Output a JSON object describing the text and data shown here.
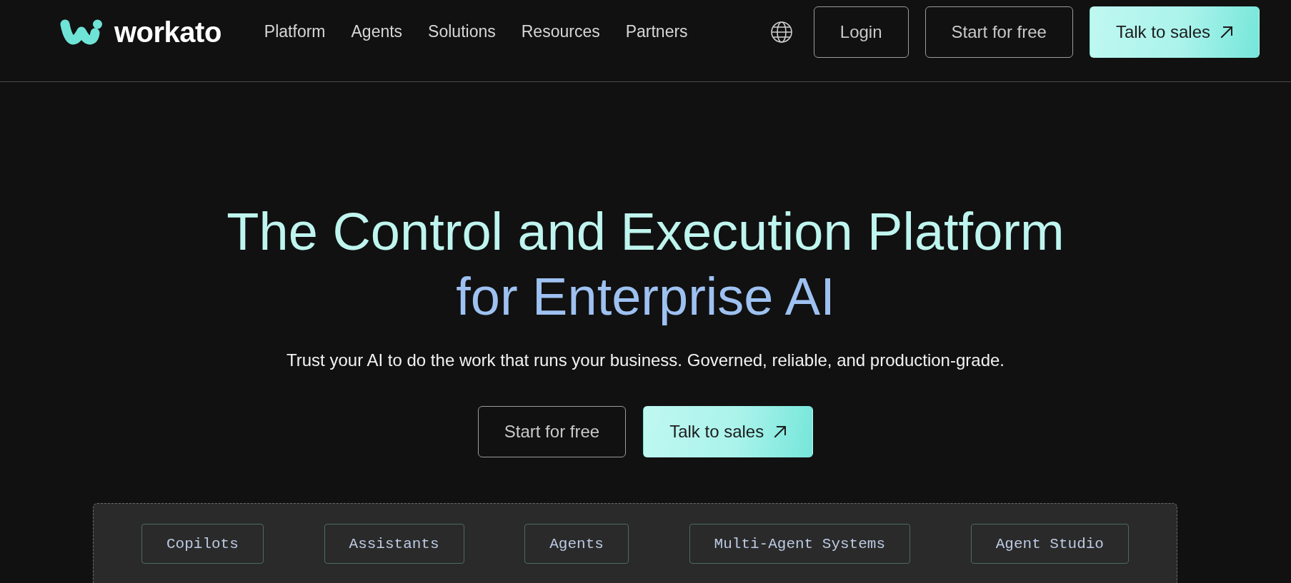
{
  "header": {
    "logo": "workato",
    "nav": [
      "Platform",
      "Agents",
      "Solutions",
      "Resources",
      "Partners"
    ],
    "buttons": [
      {
        "label": "Login",
        "kind": "outline"
      },
      {
        "label": "Start for free",
        "kind": "outline"
      },
      {
        "label": "Talk to sales",
        "kind": "primary"
      }
    ]
  },
  "hero": {
    "headline": [
      "The Control and Execution Platform",
      "for Enterprise AI"
    ],
    "subheadline": "Trust your AI to do the work that runs your business. Governed, reliable, and production-grade.",
    "buttons": [
      {
        "label": "Start for free",
        "kind": "outline"
      },
      {
        "label": "Talk to sales",
        "kind": "primary"
      }
    ]
  },
  "capabilities": [
    "Copilots",
    "Assistants",
    "Agents",
    "Multi-Agent Systems",
    "Agent Studio"
  ]
}
